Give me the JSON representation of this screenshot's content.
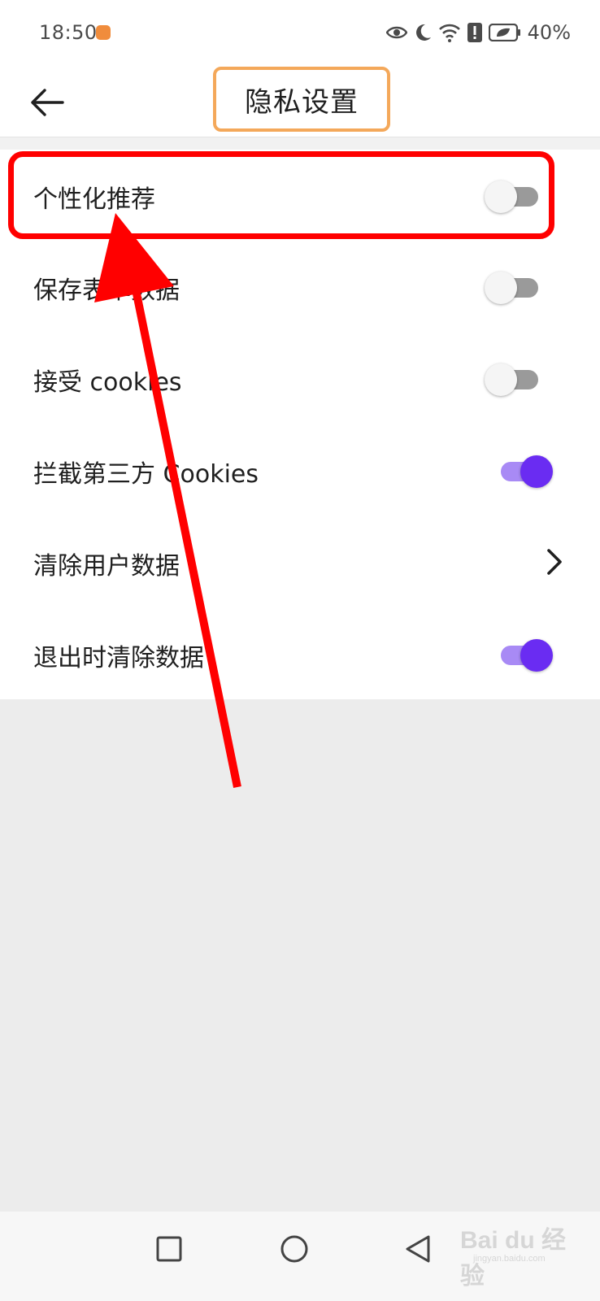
{
  "status_bar": {
    "time": "18:50",
    "battery_percent": "40%",
    "icons": [
      "eye-icon",
      "moon-icon",
      "wifi-icon",
      "alert-icon",
      "battery-icon"
    ]
  },
  "header": {
    "title": "隐私设置",
    "back_icon": "arrow-left-icon"
  },
  "settings": [
    {
      "label": "个性化推荐",
      "control": "toggle",
      "on": false
    },
    {
      "label": "保存表单数据",
      "control": "toggle",
      "on": false
    },
    {
      "label": "接受 cookies",
      "control": "toggle",
      "on": false
    },
    {
      "label": "拦截第三方 Cookies",
      "control": "toggle",
      "on": true
    },
    {
      "label": "清除用户数据",
      "control": "chevron"
    },
    {
      "label": "退出时清除数据",
      "control": "toggle",
      "on": true
    }
  ],
  "annotations": {
    "title_box_color": "#f4a85a",
    "highlight_color": "#ff0000"
  },
  "colors": {
    "toggle_on_thumb": "#6a2cf2",
    "toggle_on_track": "#a88af5",
    "toggle_off_track": "#9a9a9a"
  },
  "nav_bar": {
    "buttons": [
      "square-icon",
      "circle-icon",
      "triangle-back-icon"
    ]
  },
  "watermark": {
    "text": "Bai du 经验",
    "sub": "jingyan.baidu.com"
  }
}
